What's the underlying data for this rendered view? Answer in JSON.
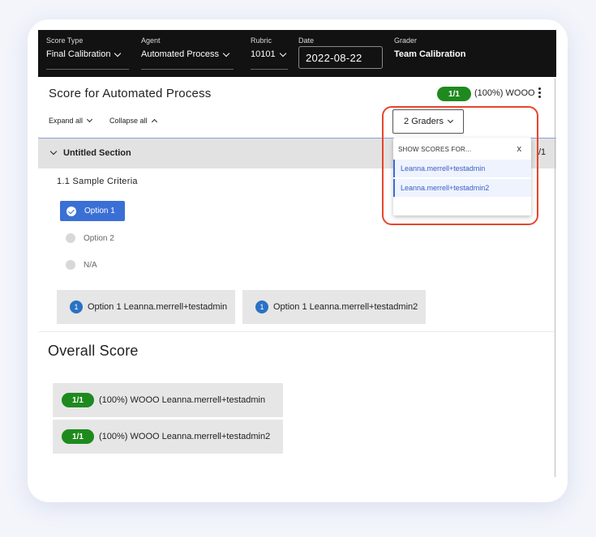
{
  "topbar": {
    "score_type": {
      "label": "Score Type",
      "value": "Final Calibration"
    },
    "agent": {
      "label": "Agent",
      "value": "Automated Process"
    },
    "rubric": {
      "label": "Rubric",
      "value": "10101"
    },
    "date": {
      "label": "Date",
      "value": "2022-08-22"
    },
    "grader": {
      "label": "Grader",
      "value": "Team Calibration"
    }
  },
  "header": {
    "title": "Score for Automated Process",
    "score_pill": "1/1",
    "score_text": "(100%) WOOO",
    "expand_all": "Expand all",
    "collapse_all": "Collapse all",
    "graders_button": "2 Graders"
  },
  "section": {
    "title": "Untitled Section",
    "fraction": "/1",
    "criteria": "1.1  Sample Criteria",
    "options": [
      "Option 1",
      "Option 2",
      "N/A"
    ],
    "selected_index": 0,
    "grader_results": [
      {
        "num": "1",
        "text": "Option 1 Leanna.merrell+testadmin"
      },
      {
        "num": "1",
        "text": "Option 1 Leanna.merrell+testadmin2"
      }
    ]
  },
  "overall": {
    "title": "Overall Score",
    "rows": [
      {
        "pill": "1/1",
        "text": "(100%) WOOO Leanna.merrell+testadmin"
      },
      {
        "pill": "1/1",
        "text": "(100%) WOOO Leanna.merrell+testadmin2"
      }
    ]
  },
  "dropdown": {
    "header": "SHOW SCORES FOR...",
    "close": "x",
    "items": [
      "Leanna.merrell+testadmin",
      "Leanna.merrell+testadmin2"
    ]
  },
  "colors": {
    "topbar_bg": "#121212",
    "accent_blue": "#3a6fd6",
    "score_green": "#1e8a1e",
    "highlight_red": "#e8452a"
  }
}
